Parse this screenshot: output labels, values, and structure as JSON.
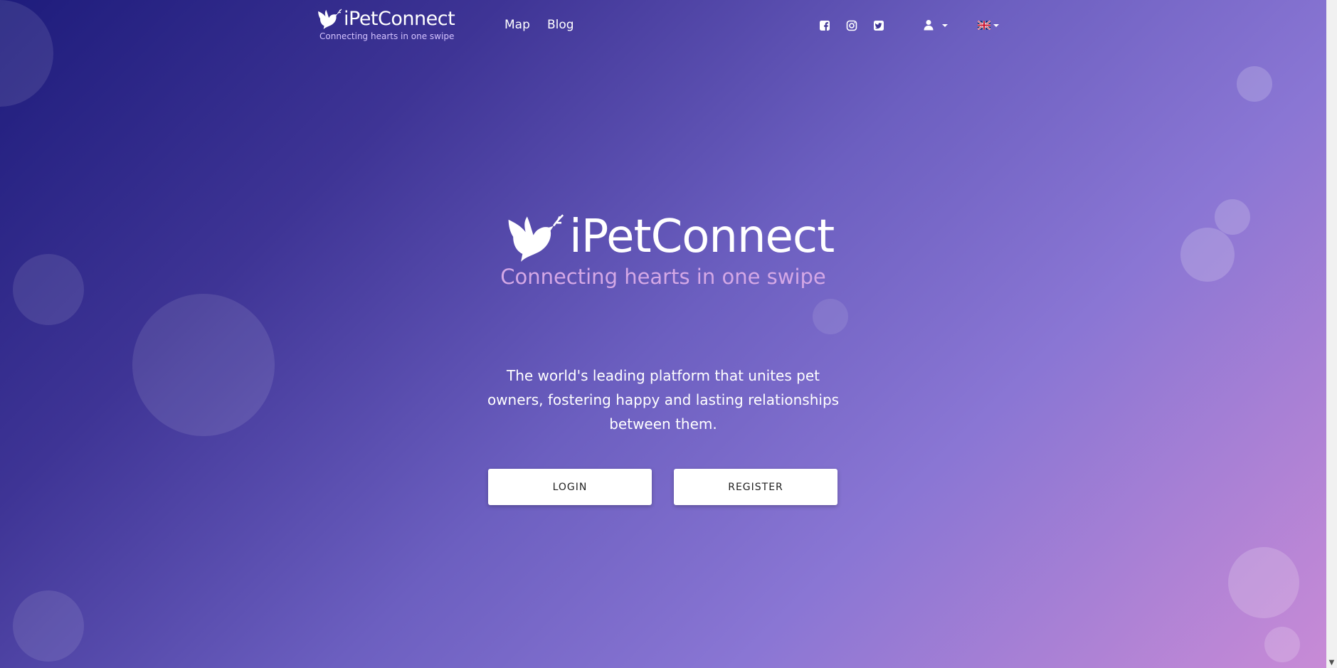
{
  "colors": {
    "gradient_start": "#1e1c7c",
    "gradient_mid": "#6c5fc0",
    "gradient_end": "#c98bd6",
    "tagline": "#d4a8e6",
    "header_tagline": "#d4c3ff",
    "button_bg": "#ffffff",
    "button_text": "#222222"
  },
  "header": {
    "brand_name": "iPetConnect",
    "brand_tagline": "Connecting hearts in one swipe",
    "brand_icon": "dove-icon",
    "nav": [
      {
        "label": "Map"
      },
      {
        "label": "Blog"
      }
    ],
    "social": [
      {
        "icon": "facebook-icon"
      },
      {
        "icon": "instagram-icon"
      },
      {
        "icon": "twitter-icon"
      }
    ],
    "user_menu_icon": "user-icon",
    "language_icon": "uk-flag-icon"
  },
  "hero": {
    "title": "iPetConnect",
    "tagline": "Connecting hearts in one swipe",
    "description": "The world's leading platform that unites pet owners, fostering happy and lasting relationships between them.",
    "login_label": "LOGIN",
    "register_label": "REGISTER"
  }
}
